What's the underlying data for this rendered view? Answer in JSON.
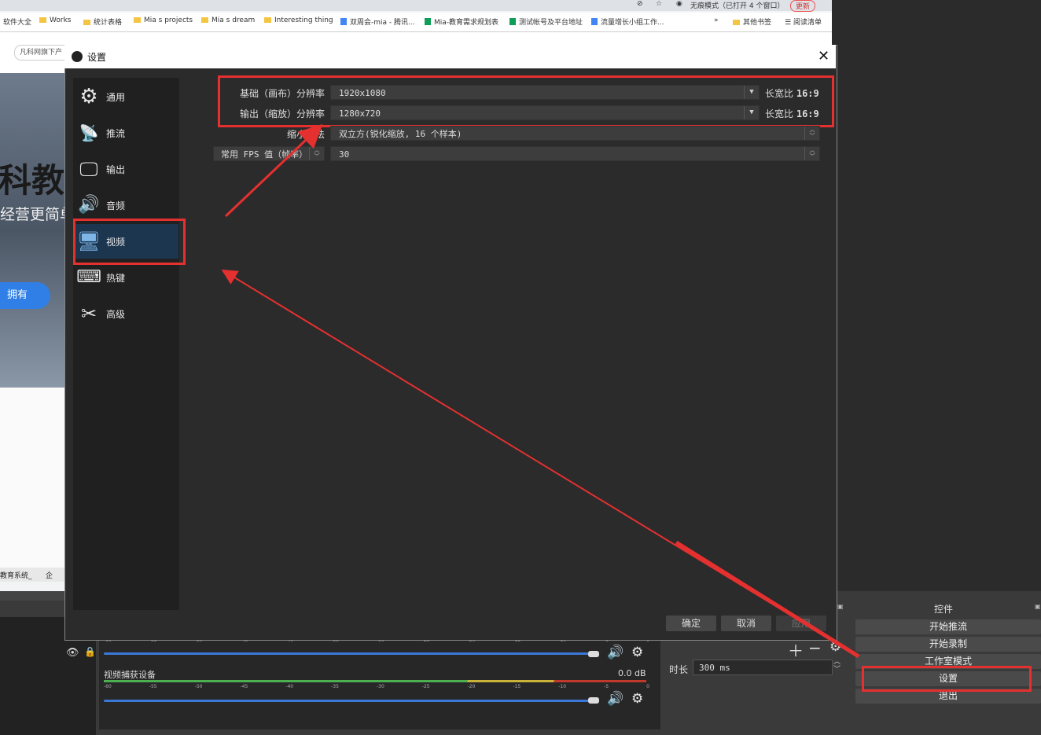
{
  "browser": {
    "top_strip": {
      "incognito_label": "无痕模式（已打开 4 个窗口）",
      "update_label": "更新"
    },
    "bookmarks": [
      "软件大全",
      "Works",
      "统计表格",
      "Mia s projects",
      "Mia s dream",
      "Interesting thing",
      "双周会-mia - 腾讯...",
      "Mia-教育需求规划表",
      "测试帐号及平台地址",
      "流量增长小组工作..."
    ],
    "bookmarks_more": "»",
    "other_bookmarks": "其他书签",
    "reading_list": "阅读清单",
    "url_text": "凡科网旗下产",
    "hero_title": "科教育",
    "hero_subtitle": "经营更简单",
    "hero_button": "拥有",
    "taskbar_items": [
      "教育系统_",
      "企"
    ]
  },
  "dialog": {
    "title": "设置",
    "nav": [
      {
        "label": "通用",
        "icon": "gear-icon"
      },
      {
        "label": "推流",
        "icon": "antenna-icon"
      },
      {
        "label": "输出",
        "icon": "output-monitor-icon"
      },
      {
        "label": "音频",
        "icon": "speaker-icon"
      },
      {
        "label": "视频",
        "icon": "monitor-icon"
      },
      {
        "label": "热键",
        "icon": "keyboard-icon"
      },
      {
        "label": "高级",
        "icon": "tools-icon"
      }
    ],
    "video": {
      "base_resolution_label": "基础（画布）分辨率",
      "base_resolution_value": "1920x1080",
      "base_aspect_label": "长宽比",
      "base_aspect_value": "16:9",
      "output_resolution_label": "输出（缩放）分辨率",
      "output_resolution_value": "1280x720",
      "output_aspect_label": "长宽比",
      "output_aspect_value": "16:9",
      "downscale_label": "缩小方法",
      "downscale_value": "双立方(锐化缩放, 16 个样本)",
      "fps_label": "常用 FPS 值（帧率）",
      "fps_value": "30"
    },
    "buttons": {
      "ok": "确定",
      "cancel": "取消",
      "apply": "应用"
    }
  },
  "obs": {
    "mixer": {
      "device_label": "视频捕获设备",
      "device_db": "0.0 dB",
      "ticks": [
        "-60",
        "-55",
        "-50",
        "-45",
        "-40",
        "-35",
        "-30",
        "-25",
        "-20",
        "-15",
        "-10",
        "-5",
        "0"
      ]
    },
    "transition": {
      "duration_label": "时长",
      "duration_value": "300 ms"
    },
    "controls": {
      "header": "控件",
      "buttons": [
        "开始推流",
        "开始录制",
        "工作室模式",
        "设置",
        "退出"
      ]
    }
  },
  "colors": {
    "annotation_red": "#e53030",
    "active_nav": "#1c3650",
    "accent_blue": "#3b78d8"
  }
}
